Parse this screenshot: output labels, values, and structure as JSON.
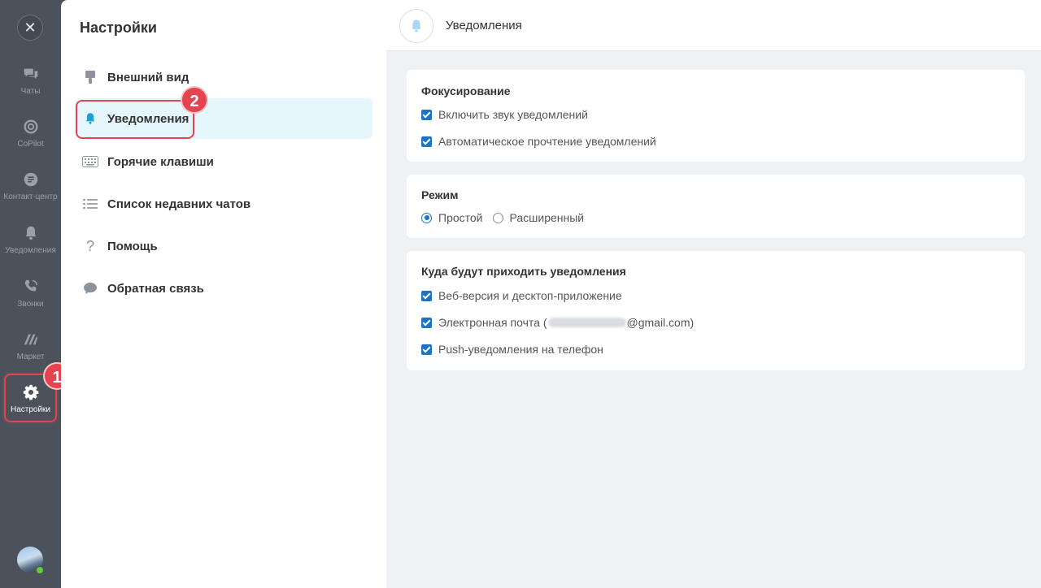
{
  "rail": {
    "close_symbol": "✕",
    "items": [
      {
        "label": "Чаты",
        "icon": "chats-icon"
      },
      {
        "label": "CoPilot",
        "icon": "copilot-icon"
      },
      {
        "label": "Контакт-центр",
        "icon": "contact-center-icon"
      },
      {
        "label": "Уведомления",
        "icon": "bell-icon"
      },
      {
        "label": "Звонки",
        "icon": "phone-icon"
      },
      {
        "label": "Маркет",
        "icon": "market-icon"
      },
      {
        "label": "Настройки",
        "icon": "gear-icon"
      }
    ],
    "badge_1": "1",
    "badge_2": "2"
  },
  "settings_panel": {
    "title": "Настройки",
    "items": [
      {
        "label": "Внешний вид",
        "icon": "brush-icon"
      },
      {
        "label": "Уведомления",
        "icon": "bell-icon",
        "active": true
      },
      {
        "label": "Горячие клавиши",
        "icon": "keyboard-icon"
      },
      {
        "label": "Список недавних чатов",
        "icon": "list-icon"
      },
      {
        "label": "Помощь",
        "icon": "question-icon"
      },
      {
        "label": "Обратная связь",
        "icon": "chat-bubble-icon"
      }
    ]
  },
  "content": {
    "header_title": "Уведомления",
    "focus": {
      "title": "Фокусирование",
      "options": [
        {
          "label": "Включить звук уведомлений",
          "checked": true
        },
        {
          "label": "Автоматическое прочтение уведомлений",
          "checked": true
        }
      ]
    },
    "mode": {
      "title": "Режим",
      "options": [
        {
          "label": "Простой",
          "selected": true
        },
        {
          "label": "Расширенный",
          "selected": false
        }
      ]
    },
    "destinations": {
      "title": "Куда будут приходить уведомления",
      "web_label": "Веб-версия и десктоп-приложение",
      "email_prefix": "Электронная почта (",
      "email_suffix": "@gmail.com)",
      "push_label": "Push-уведомления на телефон"
    }
  },
  "colors": {
    "accent": "#1d74c7",
    "highlight": "#e4434f",
    "active_bg": "#e6f6fd"
  }
}
